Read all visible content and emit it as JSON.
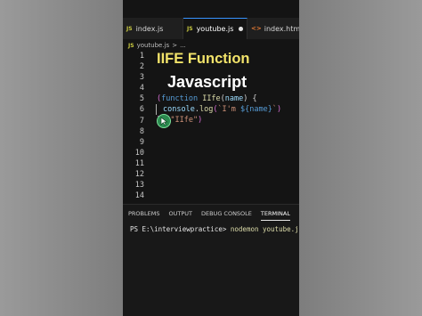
{
  "editor": {
    "tabs": [
      {
        "icon": "JS",
        "label": "index.js"
      },
      {
        "icon": "JS",
        "label": "youtube.js"
      },
      {
        "icon": "<>",
        "label": "index.html"
      }
    ],
    "breadcrumb": {
      "icon": "JS",
      "file": "youtube.js",
      "separator": ">",
      "rest": "..."
    }
  },
  "line_numbers": [
    "1",
    "2",
    "3",
    "4",
    "5",
    "6",
    "7",
    "8",
    "9",
    "10",
    "11",
    "12",
    "13",
    "14"
  ],
  "overlay": {
    "title": "IIFE Function",
    "subtitle": "Javascript"
  },
  "code": {
    "l6_open": "(",
    "l6_kw": "function",
    "l6_fn": " IIfe",
    "l6_p1": "(",
    "l6_param": "name",
    "l6_p2": ") {",
    "l7_obj": "console",
    "l7_dot": ".",
    "l7_fn": "log",
    "l7_p": "(",
    "l7_str1": "`I'm ",
    "l7_interp": "${name}",
    "l7_str2": "`",
    "l7_close": ")",
    "l8_close": "})",
    "l8_p": "(",
    "l8_str": "\"IIfe\"",
    "l8_end": ")"
  },
  "terminal": {
    "tabs": [
      "PROBLEMS",
      "OUTPUT",
      "DEBUG CONSOLE",
      "TERMINAL"
    ],
    "prompt": "PS E:\\interviewpractice> ",
    "command": "nodemon youtube.j"
  },
  "colors": {
    "accent": "#3794ff",
    "overlay_title": "#f2e36a",
    "background": "#141414"
  }
}
